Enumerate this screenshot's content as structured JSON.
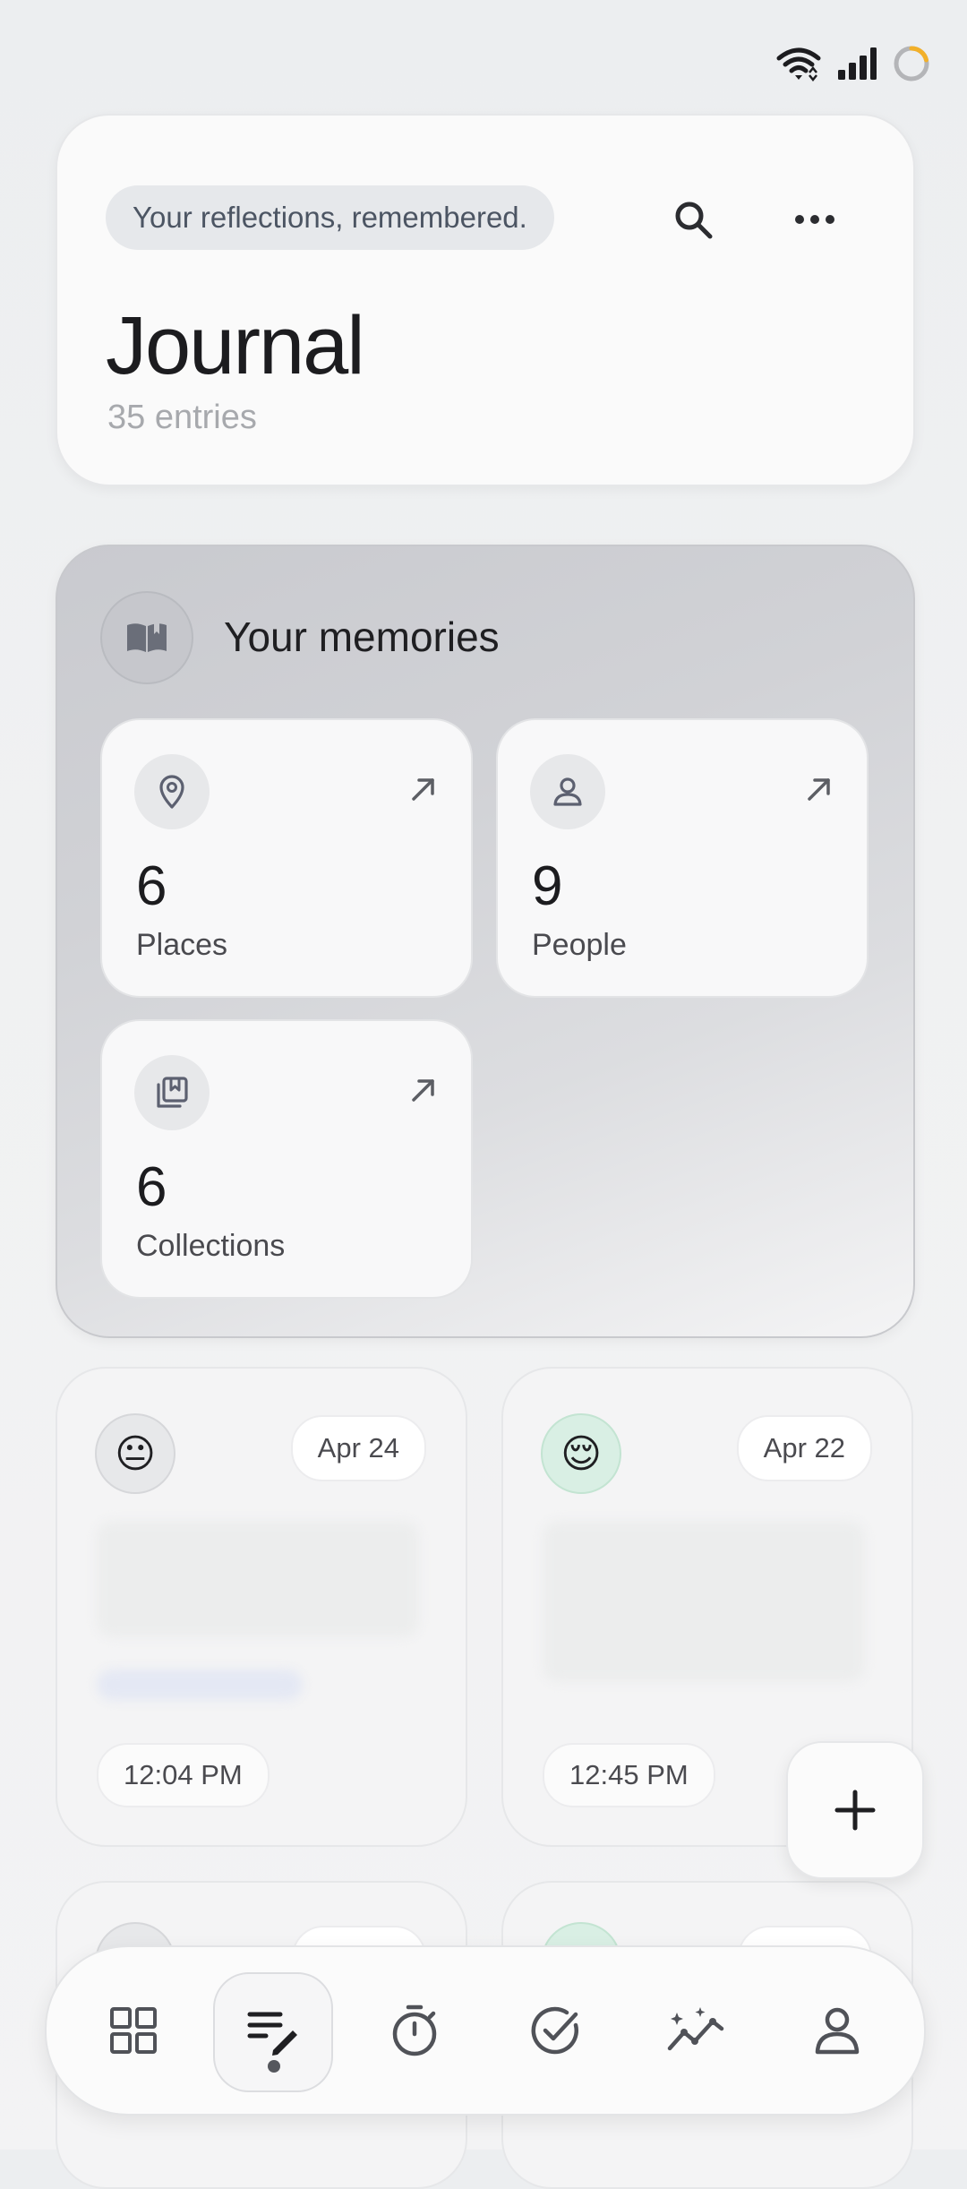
{
  "status_bar": {
    "icons": [
      "wifi-icon",
      "signal-icon",
      "battery-ring-icon"
    ],
    "battery_ring_color": "#f2b02a"
  },
  "header": {
    "tagline": "Your reflections, remembered.",
    "title": "Journal",
    "entries_count": "35 entries",
    "actions": [
      "search-icon",
      "more-icon"
    ]
  },
  "memories": {
    "title": "Your memories",
    "icon": "book-open-icon",
    "tiles": [
      {
        "count": "6",
        "label": "Places",
        "icon": "map-pin-icon"
      },
      {
        "count": "9",
        "label": "People",
        "icon": "person-icon"
      },
      {
        "count": "6",
        "label": "Collections",
        "icon": "bookmark-stack-icon"
      }
    ]
  },
  "entries": [
    {
      "mood": "😐",
      "date": "Apr 24",
      "time": "12:04 PM",
      "mood_bg": "#e7e8ea"
    },
    {
      "mood": "😌",
      "date": "Apr 22",
      "time": "12:45 PM",
      "mood_bg": "#d9efe4"
    }
  ],
  "fab": {
    "icon": "plus-icon"
  },
  "bottom_nav": {
    "items": [
      "grid-icon",
      "journal-edit-icon",
      "timer-icon",
      "check-circle-icon",
      "insights-icon",
      "profile-icon"
    ],
    "active_index": 1
  }
}
